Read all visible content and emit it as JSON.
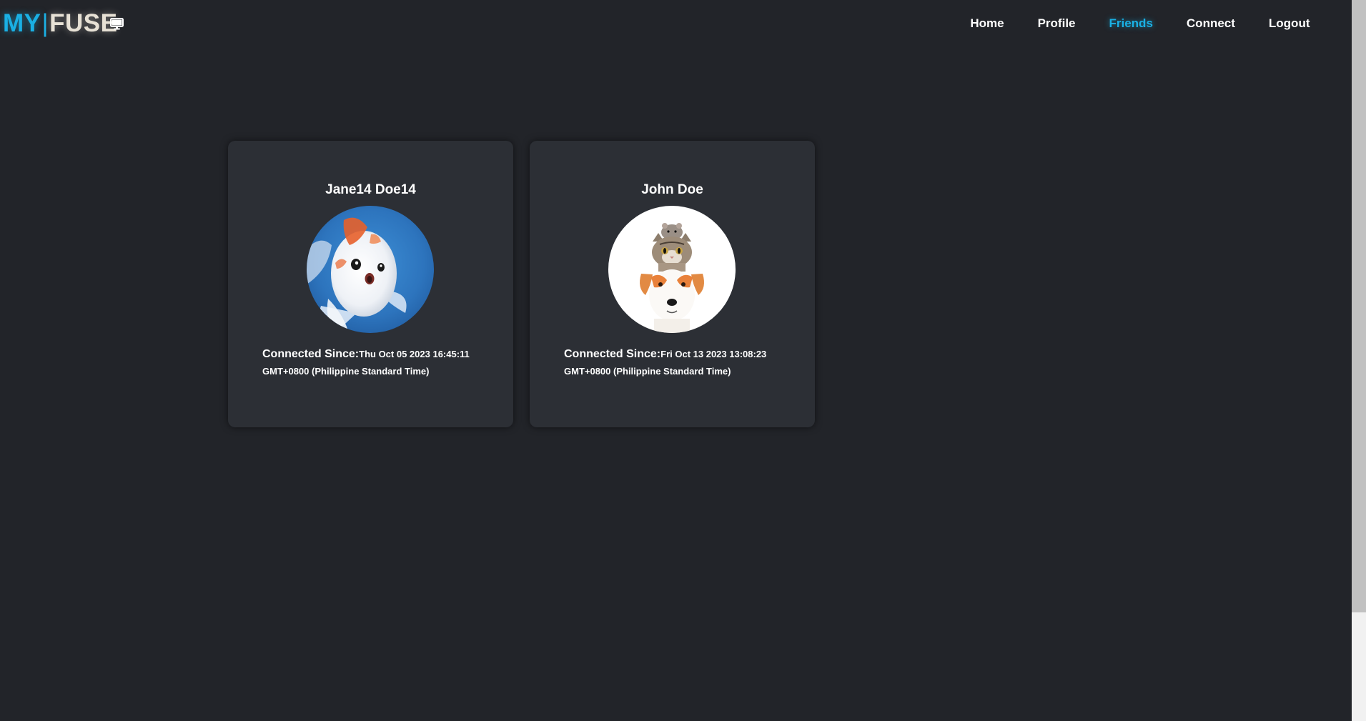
{
  "brand": {
    "my": "MY",
    "separator": "|",
    "fuse": "FUSE",
    "icon": "monitor-icon"
  },
  "nav": {
    "items": [
      {
        "label": "Home",
        "active": false
      },
      {
        "label": "Profile",
        "active": false
      },
      {
        "label": "Friends",
        "active": true
      },
      {
        "label": "Connect",
        "active": false
      },
      {
        "label": "Logout",
        "active": false
      }
    ]
  },
  "friends": [
    {
      "name": "Jane14 Doe14",
      "avatar": "goldfish-photo",
      "connected_label": "Connected Since:",
      "connected_date": "Thu Oct 05 2023 16:45:11 GMT+0800 (Philippine Standard Time)"
    },
    {
      "name": "John Doe",
      "avatar": "cat-dog-hamster-photo",
      "connected_label": "Connected Since:",
      "connected_date": "Fri Oct 13 2023 13:08:23 GMT+0800 (Philippine Standard Time)"
    }
  ],
  "colors": {
    "background": "#222429",
    "card": "#2c2f35",
    "accent": "#1ab0e4",
    "brand_light": "#e7e1d5"
  }
}
